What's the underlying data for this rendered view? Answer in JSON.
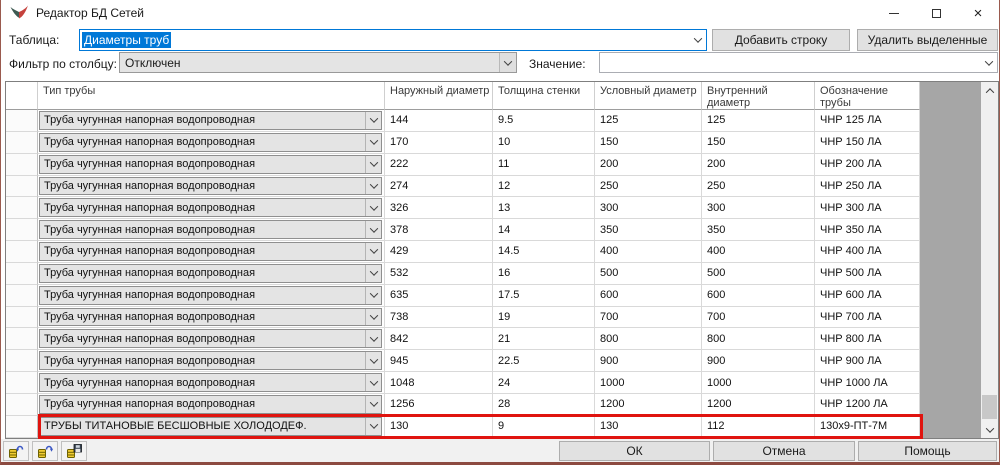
{
  "window": {
    "title": "Редактор БД Сетей",
    "controls": {
      "minimize": "",
      "maximize": "",
      "close": "×"
    }
  },
  "colors": {
    "accent": "#0078d7",
    "highlight_border": "#e0140f",
    "window_border": "#9a5a4e",
    "combo_gray": "#e4e4e4",
    "filler_gray": "#a6a6a6"
  },
  "icons": {
    "app_logo": "app-logo-icon",
    "minimize": "minimize-icon",
    "maximize": "maximize-icon",
    "close": "close-icon",
    "combo_chevron": "chevron-down-icon",
    "scroll_up": "scroll-up-icon",
    "scroll_down": "scroll-down-icon",
    "undo": "undo-database-icon",
    "redo": "redo-database-icon",
    "save": "save-database-icon"
  },
  "toolbar": {
    "table_label": "Таблица:",
    "table_value": "Диаметры труб",
    "add_row_button": "Добавить строку",
    "delete_selected_button": "Удалить выделенные"
  },
  "filter": {
    "label": "Фильтр по столбцу:",
    "value": "Отключен",
    "value_label": "Значение:",
    "value_field": ""
  },
  "table": {
    "columns": [
      "Тип трубы",
      "Наружный диаметр",
      "Толщина стенки",
      "Условный диаметр",
      "Внутренний диаметр",
      "Обозначение трубы"
    ],
    "rows": [
      {
        "type": "Труба чугунная напорная водопроводная",
        "outer": "144",
        "wall": "9.5",
        "nominal": "125",
        "inner": "125",
        "designation": "ЧНР 125 ЛА",
        "highlighted": false
      },
      {
        "type": "Труба чугунная напорная водопроводная",
        "outer": "170",
        "wall": "10",
        "nominal": "150",
        "inner": "150",
        "designation": "ЧНР 150 ЛА",
        "highlighted": false
      },
      {
        "type": "Труба чугунная напорная водопроводная",
        "outer": "222",
        "wall": "11",
        "nominal": "200",
        "inner": "200",
        "designation": "ЧНР 200 ЛА",
        "highlighted": false
      },
      {
        "type": "Труба чугунная напорная водопроводная",
        "outer": "274",
        "wall": "12",
        "nominal": "250",
        "inner": "250",
        "designation": "ЧНР 250 ЛА",
        "highlighted": false
      },
      {
        "type": "Труба чугунная напорная водопроводная",
        "outer": "326",
        "wall": "13",
        "nominal": "300",
        "inner": "300",
        "designation": "ЧНР 300 ЛА",
        "highlighted": false
      },
      {
        "type": "Труба чугунная напорная водопроводная",
        "outer": "378",
        "wall": "14",
        "nominal": "350",
        "inner": "350",
        "designation": "ЧНР 350 ЛА",
        "highlighted": false
      },
      {
        "type": "Труба чугунная напорная водопроводная",
        "outer": "429",
        "wall": "14.5",
        "nominal": "400",
        "inner": "400",
        "designation": "ЧНР 400 ЛА",
        "highlighted": false
      },
      {
        "type": "Труба чугунная напорная водопроводная",
        "outer": "532",
        "wall": "16",
        "nominal": "500",
        "inner": "500",
        "designation": "ЧНР 500 ЛА",
        "highlighted": false
      },
      {
        "type": "Труба чугунная напорная водопроводная",
        "outer": "635",
        "wall": "17.5",
        "nominal": "600",
        "inner": "600",
        "designation": "ЧНР 600 ЛА",
        "highlighted": false
      },
      {
        "type": "Труба чугунная напорная водопроводная",
        "outer": "738",
        "wall": "19",
        "nominal": "700",
        "inner": "700",
        "designation": "ЧНР 700 ЛА",
        "highlighted": false
      },
      {
        "type": "Труба чугунная напорная водопроводная",
        "outer": "842",
        "wall": "21",
        "nominal": "800",
        "inner": "800",
        "designation": "ЧНР 800 ЛА",
        "highlighted": false
      },
      {
        "type": "Труба чугунная напорная водопроводная",
        "outer": "945",
        "wall": "22.5",
        "nominal": "900",
        "inner": "900",
        "designation": "ЧНР 900 ЛА",
        "highlighted": false
      },
      {
        "type": "Труба чугунная напорная водопроводная",
        "outer": "1048",
        "wall": "24",
        "nominal": "1000",
        "inner": "1000",
        "designation": "ЧНР 1000 ЛА",
        "highlighted": false
      },
      {
        "type": "Труба чугунная напорная водопроводная",
        "outer": "1256",
        "wall": "28",
        "nominal": "1200",
        "inner": "1200",
        "designation": "ЧНР 1200 ЛА",
        "highlighted": false
      },
      {
        "type": "ТРУБЫ ТИТАНОВЫЕ БЕСШОВНЫЕ ХОЛОДОДЕФ.",
        "outer": "130",
        "wall": "9",
        "nominal": "130",
        "inner": "112",
        "designation": "130x9-ПТ-7М",
        "highlighted": true
      }
    ]
  },
  "footer": {
    "ok_button": "ОК",
    "cancel_button": "Отмена",
    "help_button": "Помощь",
    "icon_buttons": [
      "undo-database-icon",
      "redo-database-icon",
      "save-database-icon"
    ]
  }
}
